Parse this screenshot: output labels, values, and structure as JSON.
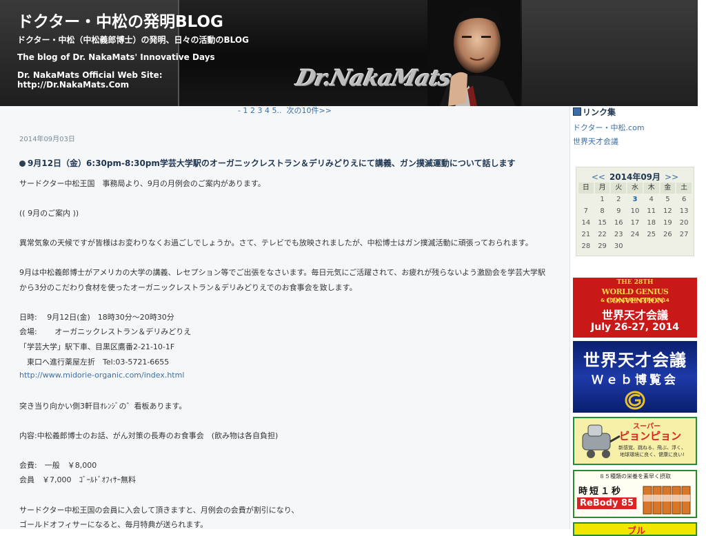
{
  "header": {
    "title": "ドクター・中松の発明BLOG",
    "subtitle_jp": "ドクター・中松（中松義郎博士）の発明、日々の活動のBLOG",
    "subtitle_en": "The blog of Dr. NakaMats' Innovative Days",
    "official_label": "Dr. NakaMats Official Web Site:",
    "official_url": "http://Dr.NakaMats.Com",
    "banner_logo": "Dr.NakaMats"
  },
  "pager": {
    "prefix": "- ",
    "pages": [
      "1",
      "2",
      "3",
      "4",
      "5"
    ],
    "suffix": "..",
    "next": "次の10件>>"
  },
  "post": {
    "date": "2014年09月03日",
    "title": "9月12日（金）6:30pm-8:30pm学芸大学駅のオーガニックレストラン＆デリみどりえにて講義、ガン撲滅運動について話します",
    "lines": [
      "サードクター中松王国　事務局より、9月の月例会のご案内があります。",
      "(( 9月のご案内 ))",
      "異常気象の天候ですが皆様はお変わりなくお過ごしでしょうか。さて、テレビでも放映されましたが、中松博士はガン撲滅活動に頑張っておられます。",
      "9月は中松義郎博士がアメリカの大学の講義、レセプション等でご出張をなさいます。毎日元気にご活躍されて、お疲れが残らないよう激励会を学芸大学駅",
      "から3分のこだわり食材を使ったオーガニックレストラン＆デリみどりえでのお食事会を致します。",
      "日時:　 9月12日(金)　18時30分～20時30分",
      "会場:　　 オーガニックレストラン＆デリみどりえ",
      "「学芸大学」駅下車、目黒区鷹番2-21-10-1F",
      "　東口へ進行薬屋左折　Tel:03-5721-6655",
      "http://www.midorie-organic.com/index.html",
      "突き当り向かい側3軒目ｵﾚﾝｼﾞの゛看板あります。",
      "内容:中松義郎博士のお話、がん対策の長寿のお食事会　(飲み物は各自負担)",
      "会費:　一般　￥8,000",
      "会員　￥7,000　ｺﾞｰﾙﾄﾞｵﾌｨｻｰ無料",
      "サードクター中松王国の会員に入会して頂きますと、月例会の会費が割引になり、",
      "ゴールドオフィサーになると、毎月特典が送られます。"
    ]
  },
  "sidebar": {
    "links_title": "リンク集",
    "links": [
      "ドクター・中松.com",
      "世界天才会議"
    ],
    "calendar": {
      "prev": "<<",
      "month": "2014年09月",
      "next": ">>",
      "dow": [
        "日",
        "月",
        "火",
        "水",
        "木",
        "金",
        "土"
      ],
      "days": [
        "",
        "1",
        "2",
        "3",
        "4",
        "5",
        "6",
        "7",
        "8",
        "9",
        "10",
        "11",
        "12",
        "13",
        "14",
        "15",
        "16",
        "17",
        "18",
        "19",
        "20",
        "21",
        "22",
        "23",
        "24",
        "25",
        "26",
        "27",
        "28",
        "29",
        "30",
        "",
        "",
        "",
        ""
      ],
      "today": "3"
    },
    "ads": {
      "ad1": {
        "line1": "THE 28TH",
        "line2": "WORLD GENIUS CONVENTION",
        "line3": "& EDUCATION EXPO 2014",
        "line4": "世界天才会議",
        "line5": "July 26-27, 2014"
      },
      "ad2": {
        "line1": "世界天才会議",
        "line2": "Ｗｅｂ博覧会"
      },
      "ad3": {
        "line1": "スーパー",
        "line2": "ピョンピョン",
        "line3": "新感覚、跳ねる、飛ぶ、浮く、",
        "line4": "地球環境に良く、健康に良い!"
      },
      "ad4": {
        "line1": "８５種類の栄養を素早く摂取",
        "line2": "時短１秒",
        "line3": "ReBody 85"
      },
      "ad5": {
        "line1": "ブル"
      }
    },
    "colors": {
      "link": "#3a6ea5",
      "today": "#1f5faa"
    }
  }
}
